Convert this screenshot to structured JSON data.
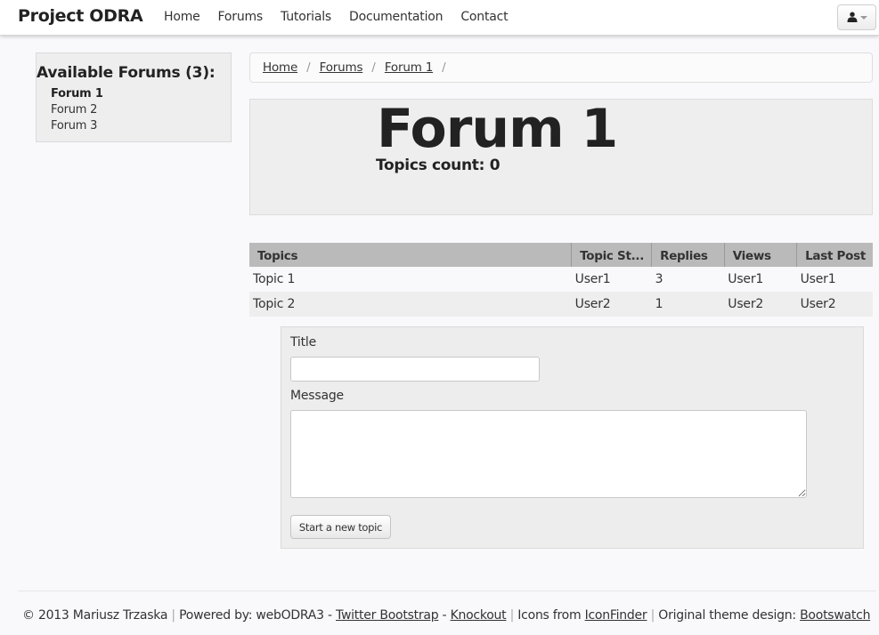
{
  "navbar": {
    "brand": "Project ODRA",
    "links": [
      "Home",
      "Forums",
      "Tutorials",
      "Documentation",
      "Contact"
    ],
    "user_menu_icon": "user-icon"
  },
  "sidebar": {
    "heading": "Available Forums (3):",
    "forums": [
      {
        "label": "Forum 1",
        "active": true
      },
      {
        "label": "Forum 2",
        "active": false
      },
      {
        "label": "Forum 3",
        "active": false
      }
    ]
  },
  "breadcrumb": {
    "items": [
      "Home",
      "Forums",
      "Forum 1"
    ],
    "separator": "/"
  },
  "hero": {
    "title": "Forum 1",
    "topics_count": "Topics count: 0"
  },
  "table": {
    "headers": [
      "Topics",
      "Topic St...",
      "Replies",
      "Views",
      "Last Post"
    ],
    "rows": [
      [
        "Topic 1",
        "User1",
        "3",
        "User1",
        "User1"
      ],
      [
        "Topic 2",
        "User2",
        "1",
        "User2",
        "User2"
      ]
    ]
  },
  "form": {
    "title_label": "Title",
    "title_value": "",
    "message_label": "Message",
    "message_value": "",
    "submit_label": "Start a new topic"
  },
  "footer": {
    "copyright": "© 2013 Mariusz Trzaska",
    "powered_by": "Powered by: webODRA3 -",
    "link_bootstrap": "Twitter Bootstrap",
    "dash": "-",
    "link_knockout": "Knockout",
    "icons_from": "Icons from",
    "link_iconfinder": "IconFinder",
    "theme_design": "Original theme design:",
    "link_bootswatch": "Bootswatch",
    "pipe": "|"
  }
}
